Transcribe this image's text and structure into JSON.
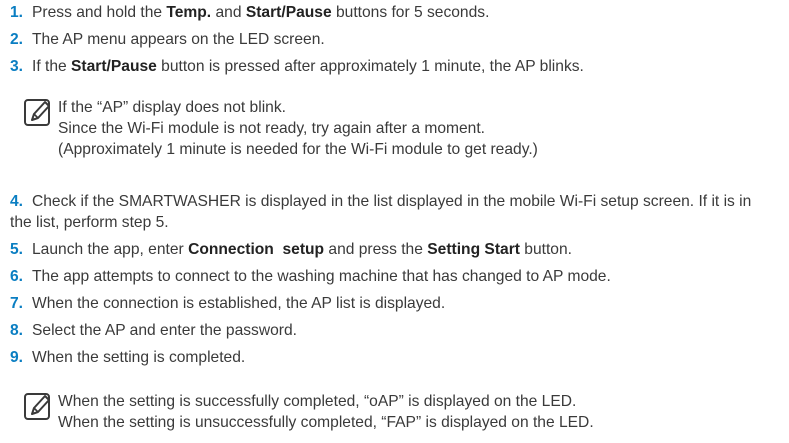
{
  "steps": [
    {
      "num": "1.",
      "parts": [
        "Press and hold the ",
        "Temp.",
        " and ",
        "Start/Pause",
        " buttons for 5 seconds."
      ]
    },
    {
      "num": "2.",
      "text": "The AP menu appears on the LED screen."
    },
    {
      "num": "3.",
      "parts": [
        "If the ",
        "Start/Pause",
        " button is pressed after approximately 1 minute, the AP blinks."
      ]
    },
    {
      "num": "4.",
      "text": "Check if the SMARTWASHER is displayed in the list displayed in the mobile Wi-Fi setup screen. If it is in the list, perform step 5."
    },
    {
      "num": "5.",
      "parts": [
        "Launch the app, enter ",
        "Connection  setup",
        " and press the ",
        "Setting Start",
        " button."
      ]
    },
    {
      "num": "6.",
      "text": "The app attempts to connect to the washing machine that has changed to AP mode."
    },
    {
      "num": "7.",
      "text": "When the connection is established, the AP list is displayed."
    },
    {
      "num": "8.",
      "text": "Select the AP and enter the password."
    },
    {
      "num": "9.",
      "text": "When the setting is completed."
    }
  ],
  "notes": [
    {
      "icon": "note-pencil-icon",
      "lines": [
        "If the “AP” display does not blink.",
        "Since the Wi-Fi module is not ready, try again after a moment.",
        "(Approximately 1 minute is needed for the Wi-Fi module to get ready.)"
      ]
    },
    {
      "icon": "note-pencil-icon",
      "lines": [
        "When the setting is successfully completed, “oAP” is displayed on the LED.",
        "When the setting is unsuccessfully completed, “FAP” is displayed on the LED."
      ]
    }
  ],
  "colors": {
    "step_number": "#0a7ec2",
    "text": "#3a3a3a"
  }
}
